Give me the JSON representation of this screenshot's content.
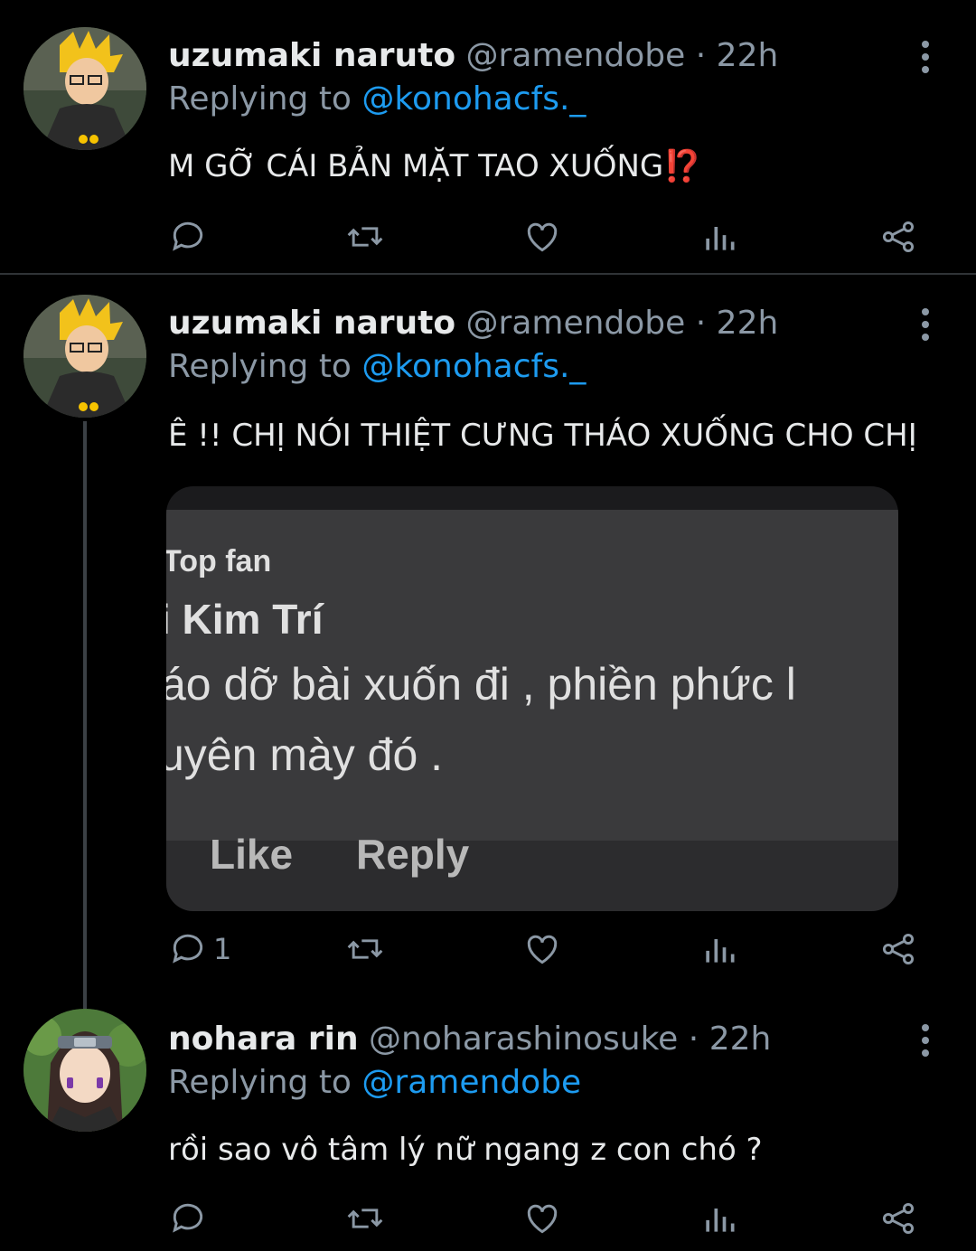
{
  "tweets": [
    {
      "name": "uzumaki naruto",
      "handle": "@ramendobe",
      "separator": "·",
      "time": "22h",
      "replying_prefix": "Replying to",
      "replying_to": "@konohacfs._",
      "text": "M GỠ CÁI BẢN MẶT TAO XUỐNG",
      "text_emoji": "⁉️",
      "reply_count": "",
      "avatar_icon": "naruto-avatar"
    },
    {
      "name": "uzumaki naruto",
      "handle": "@ramendobe",
      "separator": "·",
      "time": "22h",
      "replying_prefix": "Replying to",
      "replying_to": "@konohacfs._",
      "text": "Ê !! CHỊ NÓI THIỆT CƯNG THÁO XUỐNG CHO CHỊ",
      "reply_count": "1",
      "avatar_icon": "naruto-avatar",
      "media": {
        "label": "Top fan",
        "name": "i Kim Trí",
        "line1": "áo dỡ bài xuốn đi , phiền phức l",
        "line2": "uyên mày đó .",
        "like": "Like",
        "reply": "Reply"
      }
    },
    {
      "name": "nohara rin",
      "handle": "@noharashinosuke",
      "separator": "·",
      "time": "22h",
      "replying_prefix": "Replying to",
      "replying_to": "@ramendobe",
      "text": "rồi sao vô tâm lý nữ ngang z con chó ?",
      "reply_count": "",
      "avatar_icon": "rin-avatar"
    }
  ],
  "colors": {
    "background": "#000000",
    "text": "#e7e9ea",
    "secondary": "#8b98a5",
    "mention": "#1d9bf0"
  }
}
